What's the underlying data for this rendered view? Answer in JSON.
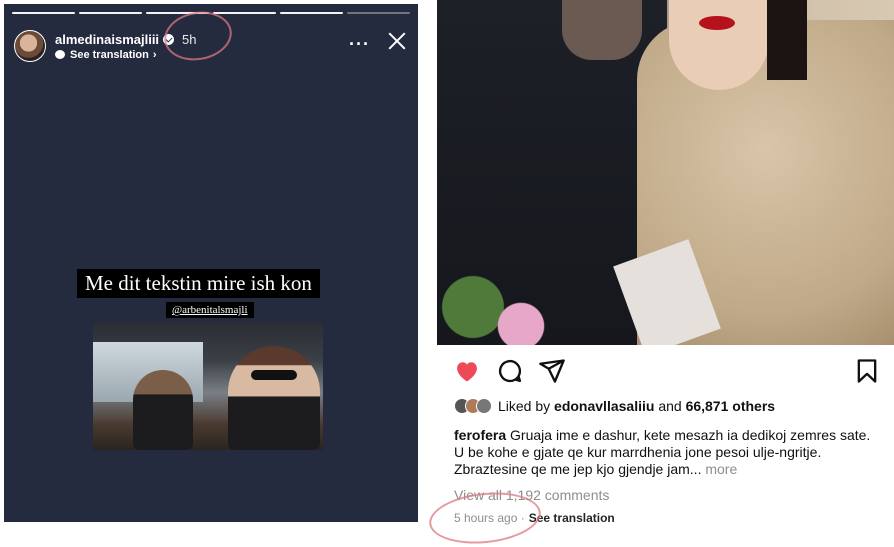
{
  "story": {
    "username": "almedinaismajliii",
    "time": "5h",
    "see_translation": "See translation",
    "text": "Me dit tekstin mire ish kon",
    "mention": "@arbenitalsmajli",
    "progress_segments": 6,
    "progress_done": 5,
    "icons": [
      "verified-icon",
      "more-icon",
      "close-icon",
      "chevron-right-icon"
    ]
  },
  "post": {
    "liked_prefix": "Liked by",
    "liked_user": "edonavllasaliiu",
    "liked_and": "and",
    "liked_others": "66,871 others",
    "caption_user": "ferofera",
    "caption_text": "Gruaja ime e dashur, kete mesazh ia dedikoj zemres sate. U be kohe e gjate qe kur marrdhenia jone pesoi ulje-ngritje. Zbraztesine qe me jep kjo gjendje jam...",
    "caption_more": "more",
    "view_comments": "View all 1,192 comments",
    "timestamp": "5 hours ago",
    "separator": "·",
    "see_translation": "See translation",
    "colors": {
      "heart": "#ed4956"
    },
    "icons": [
      "heart-icon",
      "comment-icon",
      "share-icon",
      "bookmark-icon"
    ]
  }
}
